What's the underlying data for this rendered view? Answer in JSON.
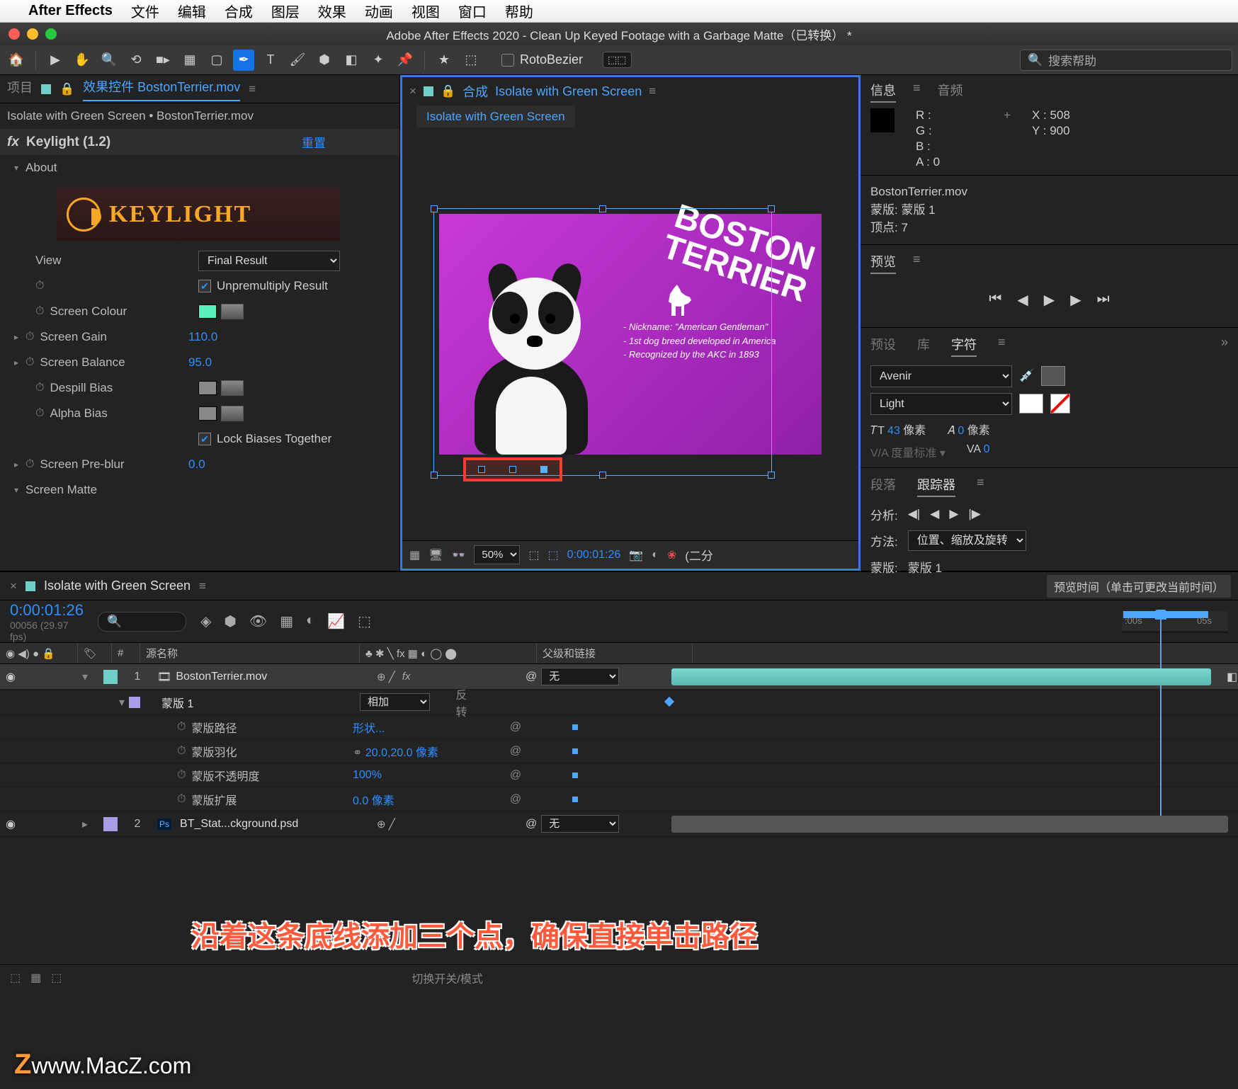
{
  "mac_menu": {
    "items": [
      "文件",
      "编辑",
      "合成",
      "图层",
      "效果",
      "动画",
      "视图",
      "窗口",
      "帮助"
    ],
    "app": "After Effects"
  },
  "titlebar": {
    "title": "Adobe After Effects 2020 - Clean Up Keyed Footage with a Garbage Matte（已转换） *"
  },
  "toolbar": {
    "roto_label": "RotoBezier",
    "search_placeholder": "搜索帮助",
    "mask_btn": "⬚⬚"
  },
  "fx_panel": {
    "tab_project": "项目",
    "tab_fx": "效果控件 BostonTerrier.mov",
    "path": "Isolate with Green Screen • BostonTerrier.mov",
    "effect_name": "Keylight (1.2)",
    "reset": "重置",
    "about": "About",
    "logo_text": "KEYLIGHT",
    "rows": {
      "view": {
        "label": "View",
        "value": "Final Result"
      },
      "unpremult": {
        "label": "Unpremultiply Result"
      },
      "screen_colour": {
        "label": "Screen Colour"
      },
      "screen_gain": {
        "label": "Screen Gain",
        "value": "110.0"
      },
      "screen_balance": {
        "label": "Screen Balance",
        "value": "95.0"
      },
      "despill": {
        "label": "Despill Bias"
      },
      "alpha_bias": {
        "label": "Alpha Bias"
      },
      "lock_biases": {
        "label": "Lock Biases Together"
      },
      "preblur": {
        "label": "Screen Pre-blur",
        "value": "0.0"
      },
      "screen_matte": {
        "label": "Screen Matte"
      }
    }
  },
  "comp": {
    "tab_label_prefix": "合成",
    "tab_name": "Isolate with Green Screen",
    "subtab": "Isolate with Green Screen",
    "zoom": "50%",
    "timecode": "0:00:01:26",
    "quality_label": "(二分",
    "poster": {
      "title_line1": "BOSTON",
      "title_line2": "TERRIER",
      "fact1": "- Nickname: \"American Gentleman\"",
      "fact2": "- 1st dog breed developed in America",
      "fact3": "- Recognized by the AKC in 1893"
    }
  },
  "right": {
    "info": {
      "tab1": "信息",
      "tab2": "音频",
      "R": "R :",
      "G": "G :",
      "B": "B :",
      "A": "A :",
      "A_val": "0",
      "X": "X :",
      "X_val": "508",
      "Y": "Y :",
      "Y_val": "900"
    },
    "mask": {
      "file": "BostonTerrier.mov",
      "mask_label": "蒙版: 蒙版 1",
      "vertices": "顶点: 7"
    },
    "preview": {
      "label": "预览"
    },
    "panel_tabs": {
      "preset": "预设",
      "lib": "库",
      "char": "字符"
    },
    "char": {
      "font": "Avenir",
      "weight": "Light",
      "size_label": "像素",
      "size_val": "43",
      "leading_label": "像素",
      "leading_val": "0",
      "metrics": "度量标准"
    },
    "para": {
      "tab": "段落"
    },
    "tracker": {
      "tab": "跟踪器",
      "analyze": "分析:",
      "method": "方法:",
      "method_val": "位置、缩放及旋转",
      "mask": "蒙版:",
      "mask_val": "蒙版 1"
    }
  },
  "timeline": {
    "tab": "Isolate with Green Screen",
    "tooltip": "预览时间（单击可更改当前时间）",
    "tc": "0:00:01:26",
    "fps": "00056 (29.97 fps)",
    "ruler": {
      "t0": ":00s",
      "t1": "05s"
    },
    "cols": {
      "num": "#",
      "source": "源名称",
      "switches": "♣ ✱ ╲ fx ▦ ◐ ◯ ⬤",
      "parent": "父级和链接"
    },
    "layer1": {
      "num": "1",
      "name": "BostonTerrier.mov",
      "mode": "无"
    },
    "mask1": {
      "name": "蒙版 1",
      "mode": "相加",
      "invert": "反转"
    },
    "props": {
      "path": {
        "label": "蒙版路径",
        "value": "形状..."
      },
      "feather": {
        "label": "蒙版羽化",
        "value": "20.0,20.0 像素"
      },
      "opacity": {
        "label": "蒙版不透明度",
        "value": "100%"
      },
      "expansion": {
        "label": "蒙版扩展",
        "value": "0.0 像素"
      }
    },
    "layer2": {
      "num": "2",
      "name": "BT_Stat...ckground.psd",
      "mode": "无"
    },
    "footer": "切换开关/模式"
  },
  "annotation": "沿着这条底线添加三个点，确保直接单击路径",
  "watermark": "www.MacZ.com"
}
